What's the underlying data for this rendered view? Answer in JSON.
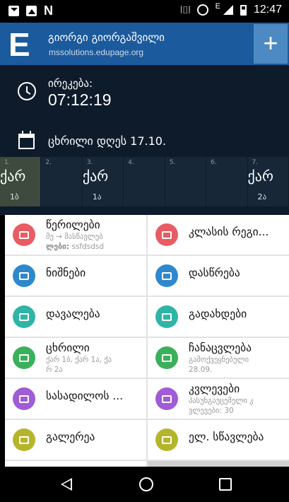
{
  "status_bar": {
    "time": "12:47",
    "network_label": "E"
  },
  "header": {
    "logo_letter": "E",
    "user_name": "გიორგი გიორგაშვილი",
    "domain": "mssolutions.edupage.org",
    "add_label": "+"
  },
  "bell": {
    "label": "ირეკება:",
    "time": "07:12:19"
  },
  "timetable": {
    "label": "ცხრილი დღეს 17.10.",
    "periods": [
      {
        "num": "1.",
        "subject": "ქარ",
        "class": "1ბ",
        "current": true
      },
      {
        "num": "2.",
        "subject": "",
        "class": ""
      },
      {
        "num": "3.",
        "subject": "ქარ",
        "class": "1ა"
      },
      {
        "num": "4.",
        "subject": "",
        "class": ""
      },
      {
        "num": "5.",
        "subject": "",
        "class": ""
      },
      {
        "num": "6.",
        "subject": "",
        "class": ""
      },
      {
        "num": "7.",
        "subject": "ქარ",
        "class": "2ა"
      }
    ]
  },
  "tiles": [
    {
      "label": "წერილები",
      "sub1": "მე → მასწავლებ",
      "sub2_bold": "ლები:",
      "sub2": " ssfdsdsd",
      "color": "#e85c63",
      "icon": "envelope-icon"
    },
    {
      "label": "კლასის რეგი...",
      "color": "#e85c63",
      "icon": "edit-icon"
    },
    {
      "label": "ნიშნები",
      "color": "#2f88cc",
      "icon": "folder-check-icon"
    },
    {
      "label": "დასწრება",
      "color": "#2f88cc",
      "icon": "refresh-icon"
    },
    {
      "label": "დავალება",
      "color": "#2fb5a6",
      "icon": "homework-icon"
    },
    {
      "label": "გადახდები",
      "color": "#2fb5a6",
      "icon": "card-icon"
    },
    {
      "label": "ცხრილი",
      "sub1": "ქარ 1ბ, ქარ 1ა, ქა",
      "sub1b": "რ 2ა",
      "color": "#3bb05a",
      "icon": "timetable-icon"
    },
    {
      "label": "ჩანაცვლება",
      "sub1": "გამოქვეყნებული",
      "sub1b": "28.09.",
      "color": "#3bb05a",
      "icon": "substitution-icon"
    },
    {
      "label": "სასადილოს ...",
      "color": "#a05bd6",
      "icon": "cup-icon"
    },
    {
      "label": "კვლევები",
      "sub1": "პასუხგაუცემელი კ",
      "sub1b": "ვლევები: 30",
      "color": "#a05bd6",
      "icon": "survey-icon"
    },
    {
      "label": "გალერეა",
      "color": "#b5b52b",
      "icon": "gallery-icon"
    },
    {
      "label": "ელ. სწავლება",
      "color": "#b5b52b",
      "icon": "elearning-icon"
    }
  ]
}
